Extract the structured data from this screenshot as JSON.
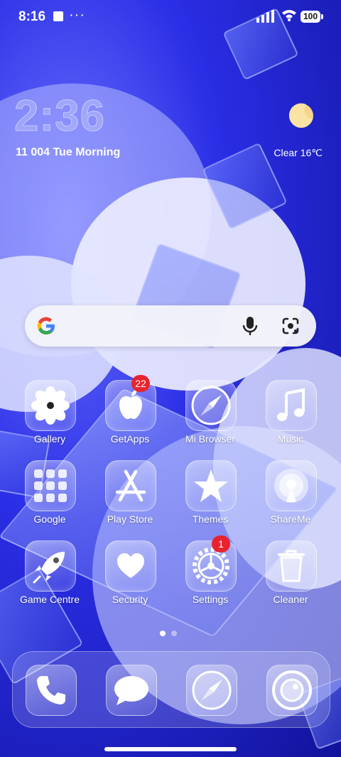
{
  "status_bar": {
    "time": "8:16",
    "more": "···",
    "battery": "100"
  },
  "widget": {
    "clock": "2:36",
    "date": "11 004 Tue Morning",
    "weather": "Clear 16℃",
    "weather_icon": "moon-icon"
  },
  "search": {
    "logo": "google-g-icon",
    "voice": "mic-icon",
    "lens": "camera-lens-icon"
  },
  "apps": [
    {
      "label": "Gallery",
      "icon": "flower-icon"
    },
    {
      "label": "GetApps",
      "icon": "apple-icon",
      "badge": "22"
    },
    {
      "label": "Mi Browser",
      "icon": "compass-icon"
    },
    {
      "label": "Music",
      "icon": "music-note-icon"
    },
    {
      "label": "Google",
      "icon": "google-folder-icon"
    },
    {
      "label": "Play Store",
      "icon": "app-store-icon"
    },
    {
      "label": "Themes",
      "icon": "star-icon"
    },
    {
      "label": "ShareMe",
      "icon": "share-icon"
    },
    {
      "label": "Game Centre",
      "icon": "rocket-icon"
    },
    {
      "label": "Security",
      "icon": "heart-icon"
    },
    {
      "label": "Settings",
      "icon": "gear-icon",
      "badge": "1"
    },
    {
      "label": "Cleaner",
      "icon": "trash-icon"
    }
  ],
  "page_indicator": {
    "pages": 2,
    "current": 1
  },
  "dock": [
    {
      "icon": "phone-icon"
    },
    {
      "icon": "message-icon"
    },
    {
      "icon": "compass-icon"
    },
    {
      "icon": "camera-icon"
    }
  ],
  "colors": {
    "badge": "#e8232f",
    "wallpaper": "#1b1fd6"
  }
}
